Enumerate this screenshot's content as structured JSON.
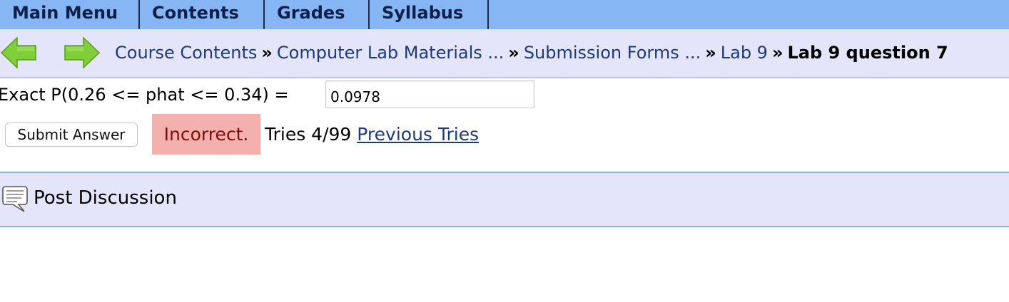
{
  "nav": {
    "tabs": [
      {
        "label": "Main Menu"
      },
      {
        "label": "Contents"
      },
      {
        "label": "Grades"
      },
      {
        "label": "Syllabus"
      }
    ]
  },
  "breadcrumb": {
    "back_icon": "left-arrow-icon",
    "forward_icon": "right-arrow-icon",
    "items": [
      "Course Contents",
      "Computer Lab Materials ...",
      "Submission Forms ...",
      "Lab 9"
    ],
    "separator": "»",
    "current": "Lab 9 question 7"
  },
  "question": {
    "prompt": "Exact P(0.26 <= phat <= 0.34) =",
    "answer_value": "0.0978",
    "submit_label": "Submit Answer",
    "status": "Incorrect.",
    "tries": "Tries 4/99",
    "previous_tries_label": "Previous Tries"
  },
  "discussion": {
    "icon": "speech-bubble-icon",
    "label": "Post Discussion"
  },
  "colors": {
    "nav_bg": "#87b6f5",
    "crumb_bg": "#e4e4fa",
    "incorrect_bg": "#f4b0ad",
    "incorrect_text": "#7a0d0d",
    "link": "#1d3b78",
    "arrow_green": "#7fce3a"
  }
}
